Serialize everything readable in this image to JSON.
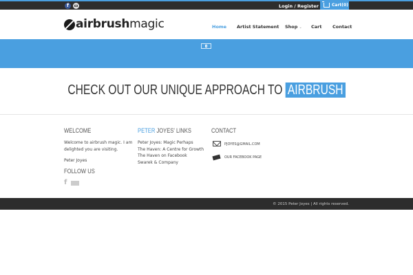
{
  "topbar": {
    "social_fb_glyph": "f",
    "login_label": "Login / Register",
    "cart_label": "Cart(0)",
    "icons": [
      "facebook-icon",
      "email-icon",
      "cart-icon"
    ]
  },
  "header": {
    "logo_bold": "airbrush",
    "logo_light": "magic",
    "nav": [
      {
        "label": "Home",
        "active": true
      },
      {
        "label": "Artist Statement",
        "active": false
      },
      {
        "label": "Shop",
        "active": false
      },
      {
        "label": "Cart",
        "active": false
      },
      {
        "label": "Contact",
        "active": false
      }
    ],
    "shop_caret": "⌄"
  },
  "tagline": {
    "text": "CHECK OUT OUR UNIQUE APPROACH TO",
    "highlight": "AIRBRUSH"
  },
  "footer": {
    "welcome": {
      "heading": "WELCOME",
      "body": "Welcome to airbrush magic. I am delighted you are visiting.",
      "signature": "Peter Joyes"
    },
    "follow": {
      "heading": "FOLLOW US",
      "fb_glyph": "f"
    },
    "links": {
      "heading_accent": "PETER",
      "heading_rest": "JOYES' LINKS",
      "items": [
        "Peter Joyes: Magic Perhaps",
        "The Haven: A Centre for Growth",
        "The Haven on Facebook",
        "Swarek & Company"
      ]
    },
    "contact": {
      "heading": "CONTACT",
      "email": "PJOYES@GMAIL.COM",
      "facebook": "OUR FACEBOOK PAGE"
    }
  },
  "bottombar": {
    "copyright": "© 2015 Peter Joyes | All rights reserved."
  },
  "colors": {
    "accent": "#4a9fe0",
    "dark_bar": "#2d2d2d"
  }
}
